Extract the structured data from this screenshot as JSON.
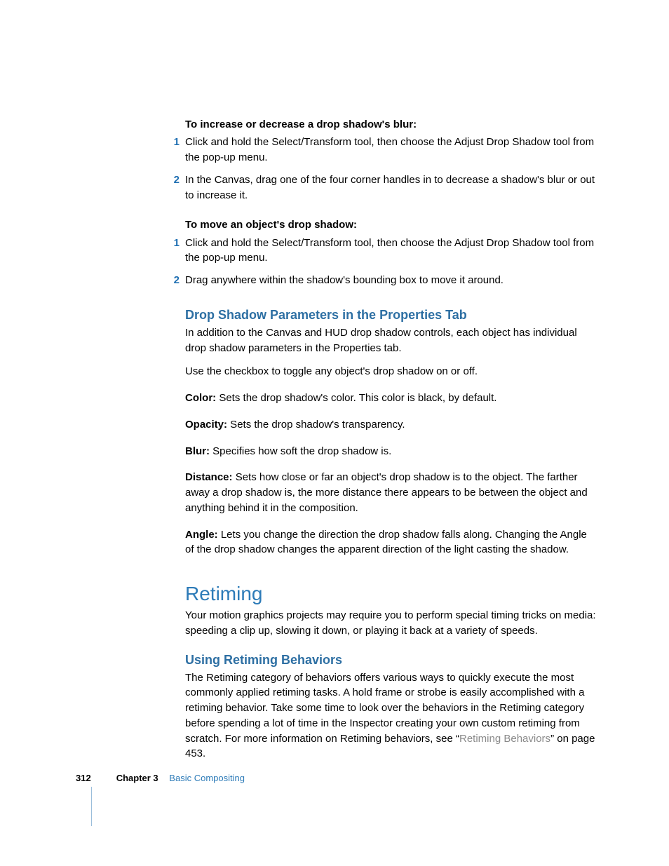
{
  "tasks": [
    {
      "title": "To increase or decrease a drop shadow's blur:",
      "steps": [
        "Click and hold the Select/Transform tool, then choose the Adjust Drop Shadow tool from the pop-up menu.",
        "In the Canvas, drag one of the four corner handles in to decrease a shadow's blur or out to increase it."
      ]
    },
    {
      "title": "To move an object's drop shadow:",
      "steps": [
        "Click and hold the Select/Transform tool, then choose the Adjust Drop Shadow tool from the pop-up menu.",
        "Drag anywhere within the shadow's bounding box to move it around."
      ]
    }
  ],
  "section1": {
    "heading": "Drop Shadow Parameters in the Properties Tab",
    "intro": "In addition to the Canvas and HUD drop shadow controls, each object has individual drop shadow parameters in the Properties tab.",
    "checkbox": "Use the checkbox to toggle any object's drop shadow on or off.",
    "params": [
      {
        "name": "Color:",
        "desc": "  Sets the drop shadow's color. This color is black, by default."
      },
      {
        "name": "Opacity:",
        "desc": "  Sets the drop shadow's transparency."
      },
      {
        "name": "Blur:",
        "desc": "  Specifies how soft the drop shadow is."
      },
      {
        "name": "Distance:",
        "desc": "  Sets how close or far an object's drop shadow is to the object. The farther away a drop shadow is, the more distance there appears to be between the object and anything behind it in the composition."
      },
      {
        "name": "Angle:",
        "desc": "  Lets you change the direction the drop shadow falls along. Changing the Angle of the drop shadow changes the apparent direction of the light casting the shadow."
      }
    ]
  },
  "section2": {
    "heading": "Retiming",
    "intro": "Your motion graphics projects may require you to perform special timing tricks on media: speeding a clip up, slowing it down, or playing it back at a variety of speeds."
  },
  "section3": {
    "heading": "Using Retiming Behaviors",
    "body_pre": "The Retiming category of behaviors offers various ways to quickly execute the most commonly applied retiming tasks. A hold frame or strobe is easily accomplished with a retiming behavior. Take some time to look over the behaviors in the Retiming category before spending a lot of time in the Inspector creating your own custom retiming from scratch. For more information on Retiming behaviors, see “",
    "link": "Retiming Behaviors",
    "body_post": "” on page 453."
  },
  "footer": {
    "page": "312",
    "chapter_label": "Chapter 3",
    "chapter_title": "Basic Compositing"
  }
}
